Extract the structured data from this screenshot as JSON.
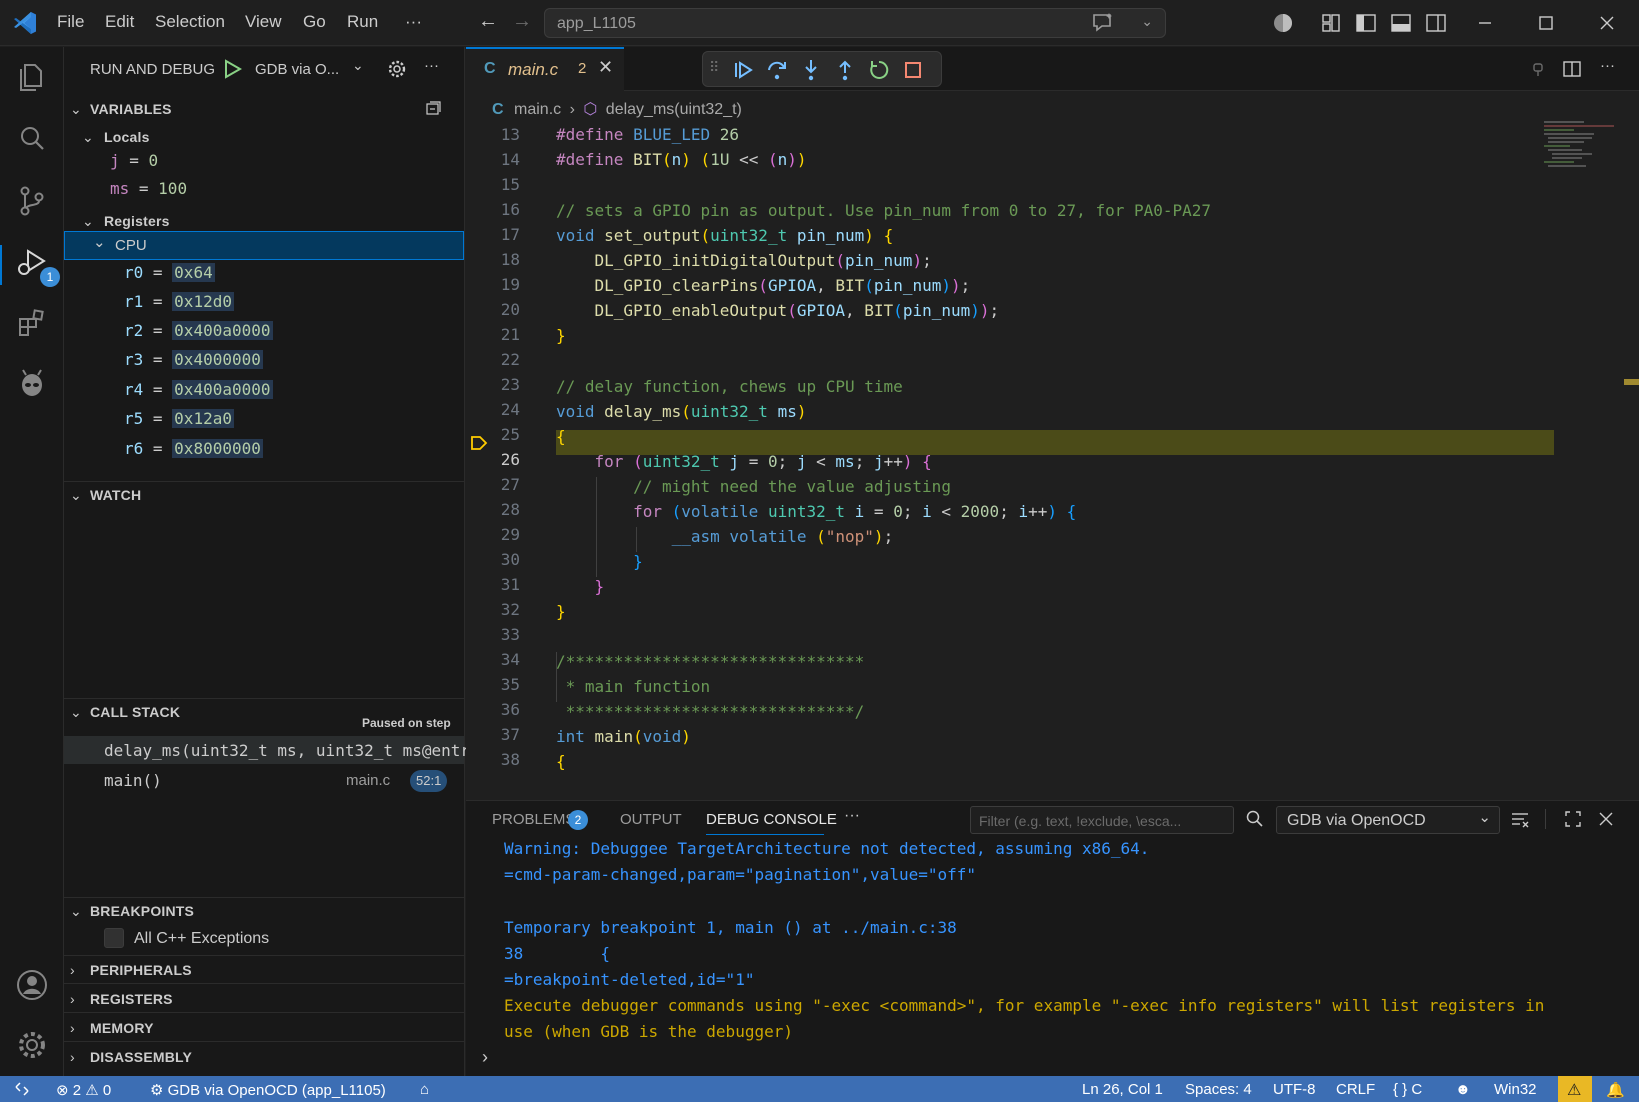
{
  "titlebar": {
    "menus": [
      "File",
      "Edit",
      "Selection",
      "View",
      "Go",
      "Run",
      "···"
    ],
    "search": "app_L1105"
  },
  "sidebar": {
    "header": "RUN AND DEBUG",
    "config": "GDB via O...",
    "variables": {
      "title": "VARIABLES",
      "locals_label": "Locals",
      "locals": [
        {
          "name": "j",
          "value": "0"
        },
        {
          "name": "ms",
          "value": "100"
        }
      ],
      "registers_label": "Registers",
      "cpu_label": "CPU",
      "registers": [
        {
          "name": "r0",
          "value": "0x64"
        },
        {
          "name": "r1",
          "value": "0x12d0"
        },
        {
          "name": "r2",
          "value": "0x400a0000"
        },
        {
          "name": "r3",
          "value": "0x4000000"
        },
        {
          "name": "r4",
          "value": "0x400a0000"
        },
        {
          "name": "r5",
          "value": "0x12a0"
        },
        {
          "name": "r6",
          "value": "0x8000000"
        }
      ]
    },
    "watch_title": "WATCH",
    "callstack": {
      "title": "CALL STACK",
      "status": "Paused on step",
      "frames": [
        {
          "name": "delay_ms(uint32_t ms, uint32_t ms@entr",
          "file": "",
          "line": ""
        },
        {
          "name": "main()",
          "file": "main.c",
          "line": "52:1"
        }
      ]
    },
    "breakpoints": {
      "title": "BREAKPOINTS",
      "item": "All C++ Exceptions"
    },
    "collapsed_sections": [
      "PERIPHERALS",
      "REGISTERS",
      "MEMORY",
      "DISASSEMBLY"
    ]
  },
  "editor": {
    "tab": {
      "name": "main.c",
      "problems": "2"
    },
    "breadcrumb": {
      "file": "main.c",
      "symbol": "delay_ms(uint32_t)"
    },
    "current_line": 26,
    "lines": [
      13,
      14,
      15,
      16,
      17,
      18,
      19,
      20,
      21,
      22,
      23,
      24,
      25,
      26,
      27,
      28,
      29,
      30,
      31,
      32,
      33,
      34,
      35,
      36,
      37,
      38
    ]
  },
  "panel": {
    "tabs": {
      "problems": "PROBLEMS",
      "problems_count": "2",
      "output": "OUTPUT",
      "debug_console": "DEBUG CONSOLE"
    },
    "filter_placeholder": "Filter (e.g. text, !exclude, \\esca...",
    "config": "GDB via OpenOCD",
    "console": [
      {
        "text": "Warning: Debuggee TargetArchitecture not detected, assuming x86_64.",
        "kind": "info"
      },
      {
        "text": "=cmd-param-changed,param=\"pagination\",value=\"off\"",
        "kind": "info"
      },
      {
        "text": "",
        "kind": "info"
      },
      {
        "text": "Temporary breakpoint 1, main () at ../main.c:38",
        "kind": "info"
      },
      {
        "text": "38\t  {",
        "kind": "info"
      },
      {
        "text": "=breakpoint-deleted,id=\"1\"",
        "kind": "info"
      },
      {
        "text": "Execute debugger commands using \"-exec <command>\", for example \"-exec info registers\" will list registers in",
        "kind": "warn"
      },
      {
        "text": "use (when GDB is the debugger)",
        "kind": "warn"
      }
    ]
  },
  "statusbar": {
    "errors": "2",
    "warnings": "0",
    "debug": "GDB via OpenOCD (app_L1105)",
    "position": "Ln 26, Col 1",
    "spaces": "Spaces: 4",
    "encoding": "UTF-8",
    "eol": "CRLF",
    "language": "C",
    "platform": "Win32"
  },
  "colors": {
    "accent": "#0078d4",
    "statusbar": "#3c6eb4",
    "current_line": "#4b4b18"
  }
}
